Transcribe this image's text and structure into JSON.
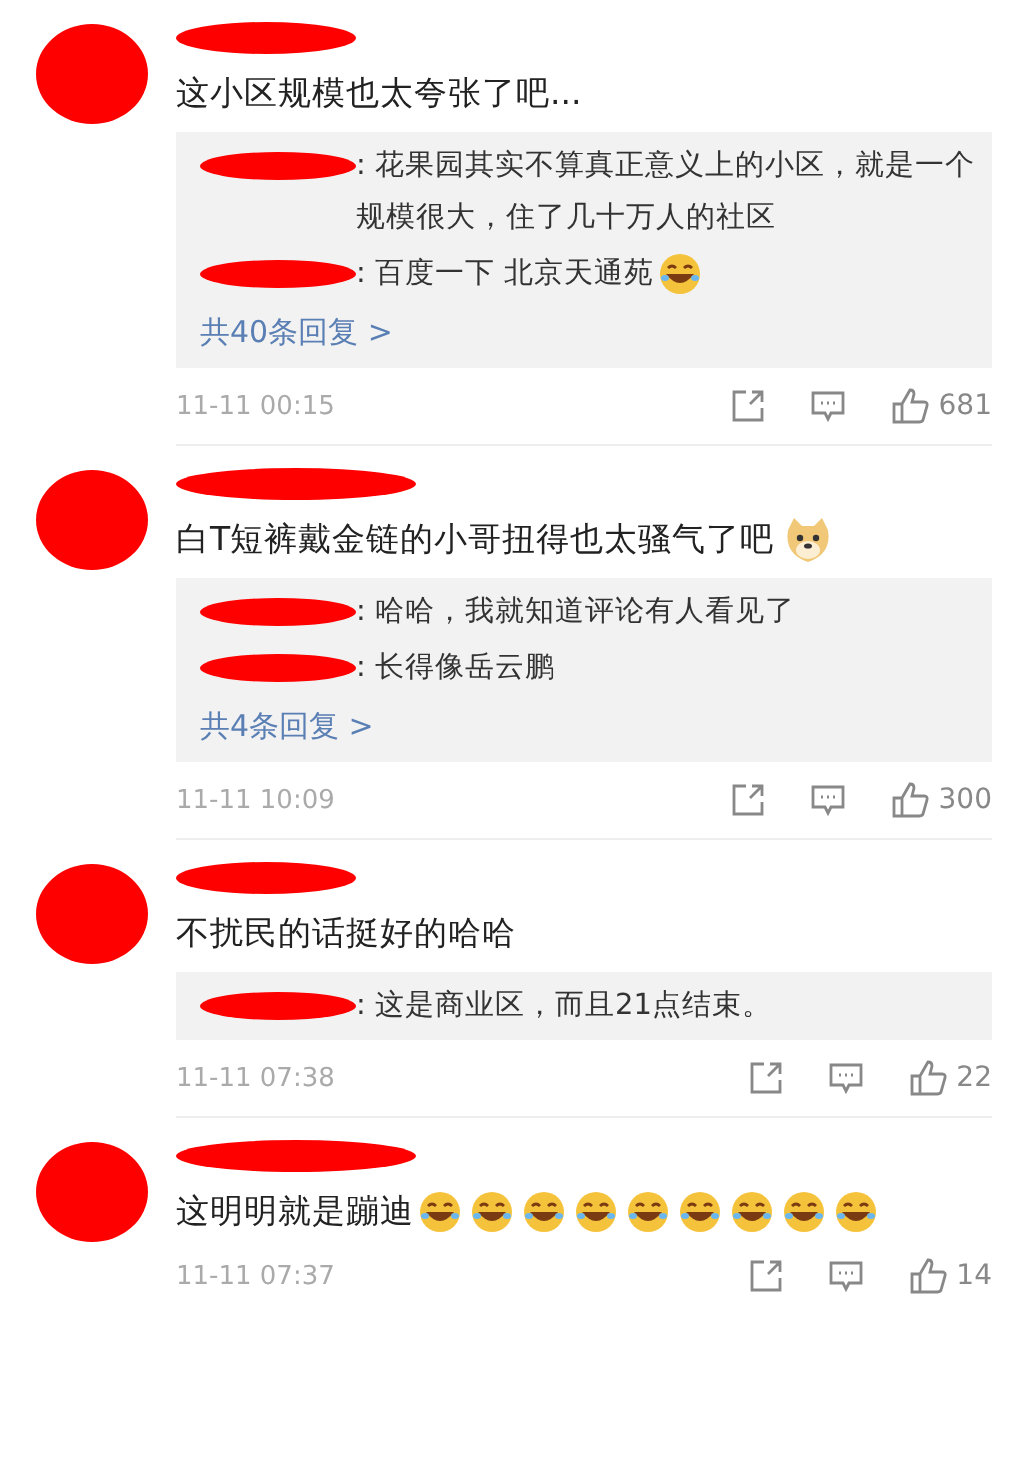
{
  "comments": [
    {
      "text": "这小区规模也太夸张了吧...",
      "replies": [
        {
          "text": ": 花果园其实不算真正意义上的小区，就是一个规模很大，住了几十万人的社区"
        },
        {
          "text": ": 百度一下  北京天通苑",
          "emojis": [
            {
              "kind": "laugh"
            }
          ]
        }
      ],
      "more": "共40条回复 >",
      "time": "11-11 00:15",
      "likes": "681"
    },
    {
      "text": "白T短裤戴金链的小哥扭得也太骚气了吧",
      "emojis": [
        {
          "kind": "doge"
        }
      ],
      "replies": [
        {
          "text": ": 哈哈，我就知道评论有人看见了"
        },
        {
          "text": ": 长得像岳云鹏"
        }
      ],
      "more": "共4条回复 >",
      "time": "11-11 10:09",
      "likes": "300"
    },
    {
      "text": "不扰民的话挺好的哈哈",
      "replies": [
        {
          "text": ": 这是商业区，而且21点结束。"
        }
      ],
      "time": "11-11 07:38",
      "likes": "22"
    },
    {
      "text": "这明明就是蹦迪",
      "emojis": [
        {
          "kind": "laugh"
        },
        {
          "kind": "laugh"
        },
        {
          "kind": "laugh"
        },
        {
          "kind": "laugh"
        },
        {
          "kind": "laugh"
        },
        {
          "kind": "laugh"
        },
        {
          "kind": "laugh"
        },
        {
          "kind": "laugh"
        },
        {
          "kind": "laugh"
        }
      ],
      "time": "11-11 07:37",
      "likes": "14"
    }
  ]
}
